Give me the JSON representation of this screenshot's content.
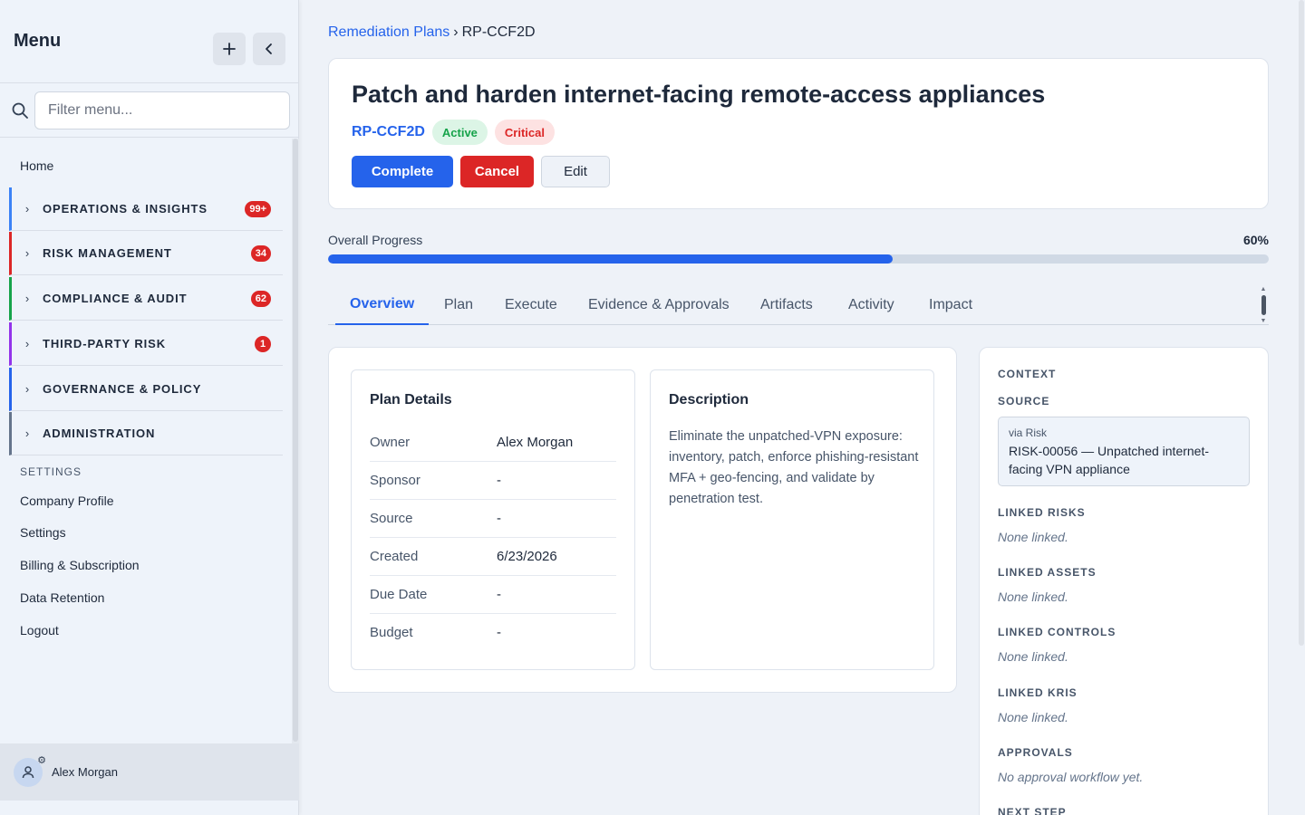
{
  "sidebar": {
    "title": "Menu",
    "search_placeholder": "Filter menu...",
    "home": "Home",
    "groups": [
      {
        "label": "OPERATIONS & INSIGHTS",
        "badge": "99+",
        "color": "#3b82f6"
      },
      {
        "label": "RISK MANAGEMENT",
        "badge": "34",
        "color": "#dc2626"
      },
      {
        "label": "COMPLIANCE & AUDIT",
        "badge": "62",
        "color": "#16a34a"
      },
      {
        "label": "THIRD-PARTY RISK",
        "badge": "1",
        "color": "#9333ea"
      },
      {
        "label": "GOVERNANCE & POLICY",
        "badge": "",
        "color": "#2563eb"
      },
      {
        "label": "ADMINISTRATION",
        "badge": "",
        "color": "#64748b"
      }
    ],
    "settings_section": "SETTINGS",
    "settings_links": [
      "Company Profile",
      "Settings",
      "Billing & Subscription",
      "Data Retention",
      "Logout"
    ],
    "user_name": "Alex Morgan"
  },
  "breadcrumb": {
    "parent": "Remediation Plans",
    "separator": "›",
    "current": "RP-CCF2D"
  },
  "plan": {
    "title": "Patch and harden internet-facing remote-access appliances",
    "id": "RP-CCF2D",
    "status": "Active",
    "severity": "Critical",
    "actions": {
      "complete": "Complete",
      "cancel": "Cancel",
      "edit": "Edit"
    }
  },
  "progress": {
    "label": "Overall Progress",
    "percent_label": "60%",
    "value": 0.6
  },
  "tabs": [
    "Overview",
    "Plan",
    "Execute",
    "Evidence & Approvals",
    "Artifacts",
    "Activity",
    "Impact"
  ],
  "details": {
    "title": "Plan Details",
    "rows": [
      {
        "key": "Owner",
        "value": "Alex Morgan"
      },
      {
        "key": "Sponsor",
        "value": "-"
      },
      {
        "key": "Source",
        "value": "-"
      },
      {
        "key": "Created",
        "value": "6/23/2026"
      },
      {
        "key": "Due Date",
        "value": "-"
      },
      {
        "key": "Budget",
        "value": "-"
      }
    ]
  },
  "description": {
    "title": "Description",
    "text": "Eliminate the unpatched-VPN exposure: inventory, patch, enforce phishing-resistant MFA + geo-fencing, and validate by penetration test."
  },
  "context": {
    "heading": "CONTEXT",
    "source_heading": "SOURCE",
    "source_via": "via Risk",
    "source_risk": "RISK-00056 — Unpatched internet-facing VPN appliance",
    "linked_risks_heading": "LINKED RISKS",
    "linked_risks_value": "None linked.",
    "linked_assets_heading": "LINKED ASSETS",
    "linked_assets_value": "None linked.",
    "linked_controls_heading": "LINKED CONTROLS",
    "linked_controls_value": "None linked.",
    "linked_kris_heading": "LINKED KRIS",
    "linked_kris_value": "None linked.",
    "approvals_heading": "APPROVALS",
    "approvals_value": "No approval workflow yet.",
    "next_step_heading": "NEXT STEP"
  }
}
